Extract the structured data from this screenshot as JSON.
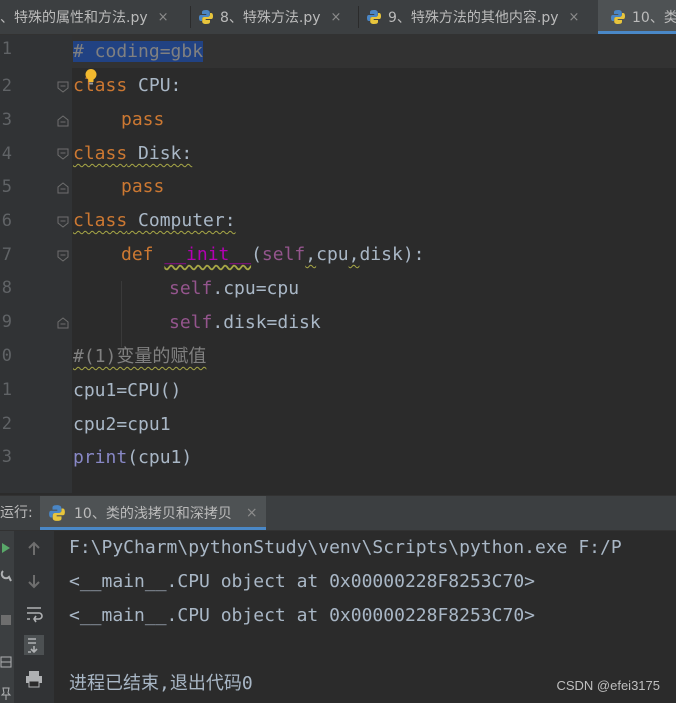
{
  "tabs": [
    {
      "label": "、特殊的属性和方法.py",
      "close": "×"
    },
    {
      "label": "8、特殊方法.py",
      "close": "×"
    },
    {
      "label": "9、特殊方法的其他内容.py",
      "close": "×"
    },
    {
      "label": "10、类",
      "close": ""
    }
  ],
  "editor": {
    "line_numbers": [
      "1",
      "2",
      "3",
      "4",
      "5",
      "6",
      "7",
      "8",
      "9",
      "0",
      "1",
      "2",
      "3"
    ],
    "code": {
      "l1": "# coding=gbk",
      "l2_kw": "class",
      "l2_name": " CPU:",
      "l3_kw": "pass",
      "l4_kw": "class",
      "l4_name": " Disk:",
      "l5_kw": "pass",
      "l6_kw": "class",
      "l6_name": " Computer:",
      "l7_kw": "def ",
      "l7_fn": "__init__",
      "l7_p1": "(",
      "l7_self": "self",
      "l7_c1": ",",
      "l7_cpu": "cpu",
      "l7_c2": ",",
      "l7_rest": "disk):",
      "l8_self": "self",
      "l8_rest": ".cpu=cpu",
      "l9_self": "self",
      "l9_rest": ".disk=disk",
      "l10": "#(1)变量的赋值",
      "l11": "cpu1=CPU()",
      "l12": "cpu2=cpu1",
      "l13_fn": "print",
      "l13_rest": "(cpu1)"
    }
  },
  "run": {
    "label": "运行:",
    "tab_label": "10、类的浅拷贝和深拷贝",
    "tab_close": "×"
  },
  "console": {
    "lines": [
      "F:\\PyCharm\\pythonStudy\\venv\\Scripts\\python.exe F:/P",
      "<__main__.CPU object at 0x00000228F8253C70>",
      "<__main__.CPU object at 0x00000228F8253C70>",
      "",
      "进程已结束,退出代码0"
    ]
  },
  "watermark": "CSDN @efei3175",
  "colors": {
    "keyword": "#cc7832",
    "self": "#94558d",
    "dunder": "#b200b2",
    "comment": "#808080",
    "text": "#a9b7c6",
    "selection": "#214283",
    "accent": "#4a88c7"
  }
}
